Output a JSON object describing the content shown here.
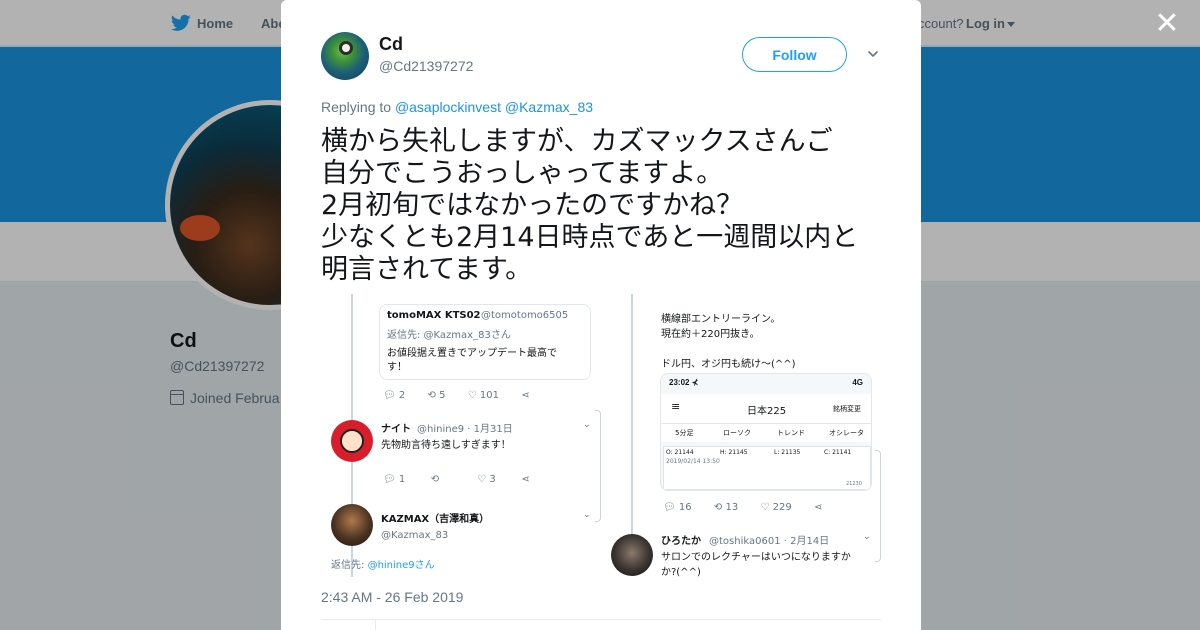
{
  "nav": {
    "home": "Home",
    "about": "Abo",
    "account_prompt": "ccount?",
    "login": "Log in"
  },
  "profile": {
    "name": "Cd",
    "handle": "@Cd21397272",
    "joined": "Joined Februa"
  },
  "colors": {
    "accent": "#1da1f2",
    "banner": "#1b95e0",
    "link": "#1b95e0"
  },
  "tweet": {
    "author_name": "Cd",
    "author_handle": "@Cd21397272",
    "follow_label": "Follow",
    "replying_to_label": "Replying to",
    "mentions": [
      "@asaplockinvest",
      "@Kazmax_83"
    ],
    "text": "横から失礼しますが、カズマックスさんご\n自分でこうおっしゃってますよ。\n2月初旬ではなかったのですかね？\n少なくとも2月14日時点であと一週間以内と\n明言されてます。",
    "timestamp": "2:43 AM - 26 Feb 2019"
  },
  "attached_image": {
    "left": {
      "quoted_author": "tomoMAX KTS02",
      "quoted_handle": "@tomotomo6505",
      "quoted_reply_to": "返信先: @Kazmax_83さん",
      "quoted_text_1": "お値段据え置きでアップデート最高で",
      "quoted_text_2": "す！",
      "actions1": {
        "reply": "2",
        "retweet": "5",
        "like": "101"
      },
      "reply1_name": "ナイト",
      "reply1_handle": "@hinine9 · 1月31日",
      "reply1_text": "先物助言待ち遠しすぎます！",
      "actions2": {
        "reply": "1",
        "retweet": "",
        "like": "3"
      },
      "reply2_name": "KAZMAX（吉澤和真）",
      "reply2_handle": "@Kazmax_83",
      "reply2_reply_to_label": "返信先: ",
      "reply2_reply_to": "@hinine9さん"
    },
    "right": {
      "text_1": "横線部エントリーライン。",
      "text_2": "現在約＋220円抜き。",
      "text_3": "ドル円、オジ円も続け～(^^)",
      "phone_time": "23:02 ⊀",
      "phone_signal": "4G",
      "phone_title": "日本225",
      "phone_action": "銘柄変更",
      "phone_tabs": [
        "5分足",
        "ローソク",
        "トレンド",
        "オシレータ"
      ],
      "ohlc": {
        "o": "O: 21144",
        "h": "H: 21145",
        "l": "L: 21135",
        "c": "C: 21141"
      },
      "chart_date": "2019/02/14 13:50",
      "chart_level": "21230",
      "actions": {
        "reply": "16",
        "retweet": "13",
        "like": "229"
      },
      "reply_name": "ひろたか",
      "reply_handle": "@toshika0601 · 2月14日",
      "reply_text_1": "サロンでのレクチャーはいつになりますか",
      "reply_text_2": "か?(^^)"
    }
  }
}
